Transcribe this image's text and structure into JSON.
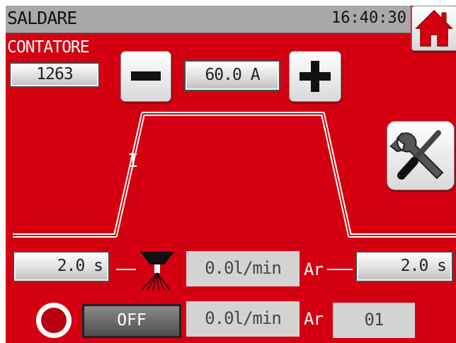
{
  "header": {
    "title": "SALDARE",
    "time": "16:40:30"
  },
  "counter": {
    "label": "CONTATORE",
    "value": "1263"
  },
  "current": {
    "value": "60.0 A"
  },
  "graph": {
    "axis_label": "I"
  },
  "pre_gas": {
    "time": "2.0 s",
    "flow": "0.0l/min",
    "gas": "Ar"
  },
  "post_gas": {
    "time": "2.0 s"
  },
  "bottom": {
    "state": "OFF",
    "flow": "0.0l/min",
    "gas": "Ar",
    "program": "01"
  },
  "icons": {
    "home": "home-icon",
    "tools": "wrench-screwdriver-icon",
    "torch": "torch-icon",
    "gas": "gas-cylinder-icon"
  },
  "colors": {
    "background": "#d40011",
    "titlebar": "#a9a9a9",
    "home_icon": "#d40011"
  }
}
